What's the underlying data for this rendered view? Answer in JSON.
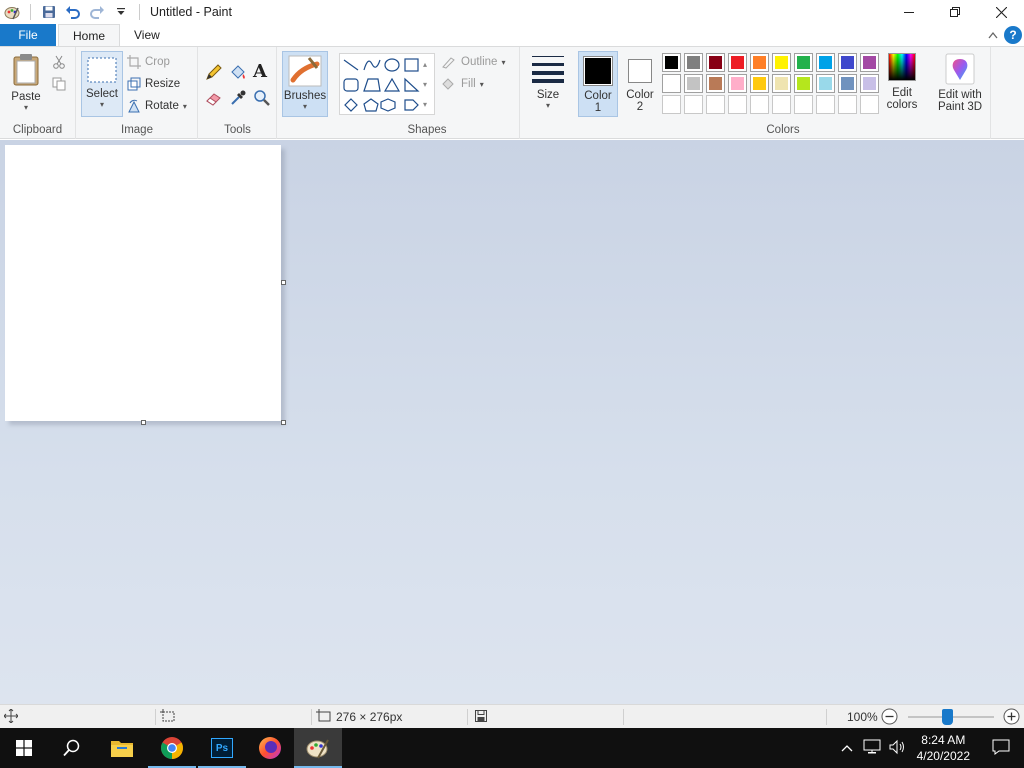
{
  "window": {
    "title": "Untitled - Paint"
  },
  "tabs": {
    "file": "File",
    "home": "Home",
    "view": "View"
  },
  "clipboard": {
    "paste": "Paste",
    "label": "Clipboard"
  },
  "image": {
    "select": "Select",
    "crop": "Crop",
    "resize": "Resize",
    "rotate": "Rotate",
    "label": "Image"
  },
  "tools": {
    "label": "Tools",
    "brushes": "Brushes"
  },
  "shapes": {
    "outline": "Outline",
    "fill": "Fill",
    "label": "Shapes"
  },
  "size": {
    "label": "Size"
  },
  "colors": {
    "color1_line1": "Color",
    "color1_line2": "1",
    "color2_line1": "Color",
    "color2_line2": "2",
    "edit_line1": "Edit",
    "edit_line2": "colors",
    "label": "Colors",
    "color1_value": "#000000",
    "color2_value": "#ffffff",
    "palette_row1": [
      "#000000",
      "#7f7f7f",
      "#880015",
      "#ed1c24",
      "#ff7f27",
      "#fff200",
      "#22b14c",
      "#00a2e8",
      "#3f48cc",
      "#a349a4"
    ],
    "palette_row2": [
      "#ffffff",
      "#c3c3c3",
      "#b97a57",
      "#ffaec9",
      "#ffc90e",
      "#efe4b0",
      "#b5e61d",
      "#99d9ea",
      "#7092be",
      "#c8bfe7"
    ]
  },
  "paint3d": {
    "line1": "Edit with",
    "line2": "Paint 3D"
  },
  "status": {
    "canvas_size": "276 × 276px",
    "zoom": "100%",
    "zoom_level": 0.45
  },
  "taskbar": {
    "time": "8:24 AM",
    "date": "4/20/2022",
    "apps": [
      "start",
      "search",
      "file-explorer",
      "chrome",
      "photoshop",
      "firefox",
      "paint"
    ]
  }
}
